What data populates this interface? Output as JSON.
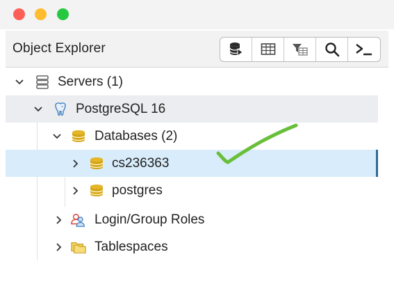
{
  "window": {
    "title_bar_buttons": [
      "close",
      "minimize",
      "zoom"
    ]
  },
  "panel": {
    "title": "Object Explorer",
    "toolbar": [
      {
        "name": "query-tool-icon"
      },
      {
        "name": "view-data-icon"
      },
      {
        "name": "filtered-rows-icon"
      },
      {
        "name": "search-objects-icon"
      },
      {
        "name": "psql-tool-icon"
      }
    ]
  },
  "tree": {
    "servers": "Servers (1)",
    "server": "PostgreSQL 16",
    "databases": "Databases (2)",
    "db1": "cs236363",
    "db2": "postgres",
    "roles": "Login/Group Roles",
    "tablespaces": "Tablespaces"
  },
  "colors": {
    "selected_row": "#d8ecfb",
    "selected_border": "#2f6a96",
    "hover_row": "#ebedf0",
    "check_annotation": "#6abf3a",
    "database_icon": "#d4a514"
  }
}
